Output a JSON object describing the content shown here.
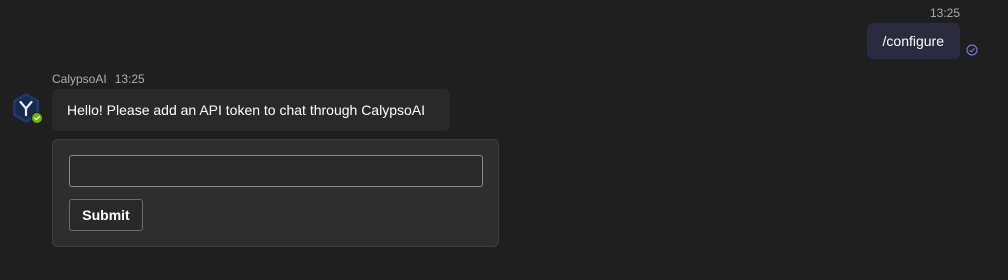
{
  "sent_message": {
    "time": "13:25",
    "text": "/configure",
    "status_icon": "check-circle-icon"
  },
  "received_message": {
    "sender": "CalypsoAI",
    "time": "13:25",
    "text": "Hello! Please add an API token to chat through CalypsoAI",
    "avatar_icon": "calypsoai-logo",
    "presence": "available"
  },
  "card": {
    "input_value": "",
    "input_placeholder": "",
    "submit_label": "Submit"
  },
  "colors": {
    "background": "#1f1f1f",
    "sent_bubble": "#2b2b40",
    "received_bubble": "#292929",
    "presence_available": "#6bb700"
  }
}
